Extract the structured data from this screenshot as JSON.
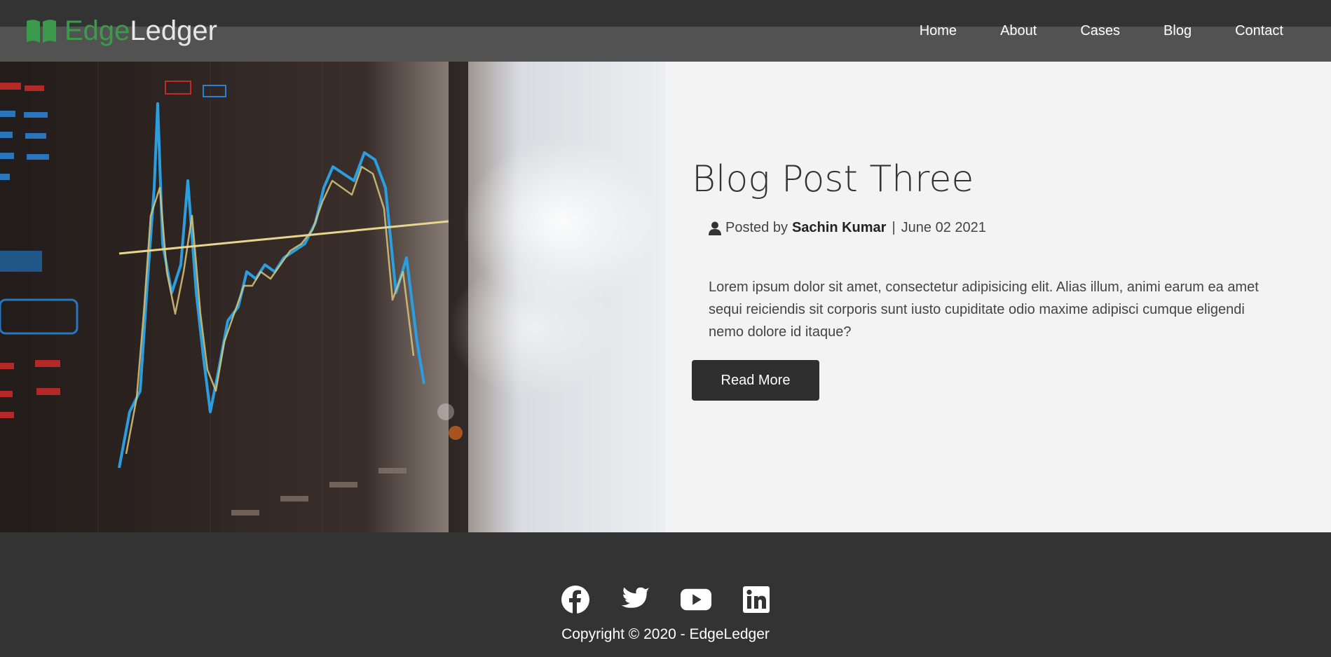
{
  "brand": {
    "part1": "Edge",
    "part2": "Ledger",
    "icon": "open-book-icon"
  },
  "nav": [
    "Home",
    "About",
    "Cases",
    "Blog",
    "Contact"
  ],
  "post": {
    "title": "Blog Post Three",
    "meta_prefix": "Posted by",
    "author": "Sachin Kumar",
    "separator": "|",
    "date": "June 02 2021",
    "excerpt": "Lorem ipsum dolor sit amet, consectetur adipisicing elit. Alias illum, animi earum ea amet sequi reiciendis sit corporis sunt iusto cupiditate odio maxime adipisci cumque eligendi nemo dolore id itaque?",
    "button": "Read More",
    "image": "stock-market-chart-on-monitor"
  },
  "footer": {
    "socials": [
      "facebook-icon",
      "twitter-icon",
      "youtube-icon",
      "linkedin-icon"
    ],
    "copyright": "Copyright © 2020 - EdgeLedger"
  },
  "colors": {
    "brand_green": "#3b9a4c",
    "dark": "#333333",
    "panel": "#f3f3f3"
  }
}
